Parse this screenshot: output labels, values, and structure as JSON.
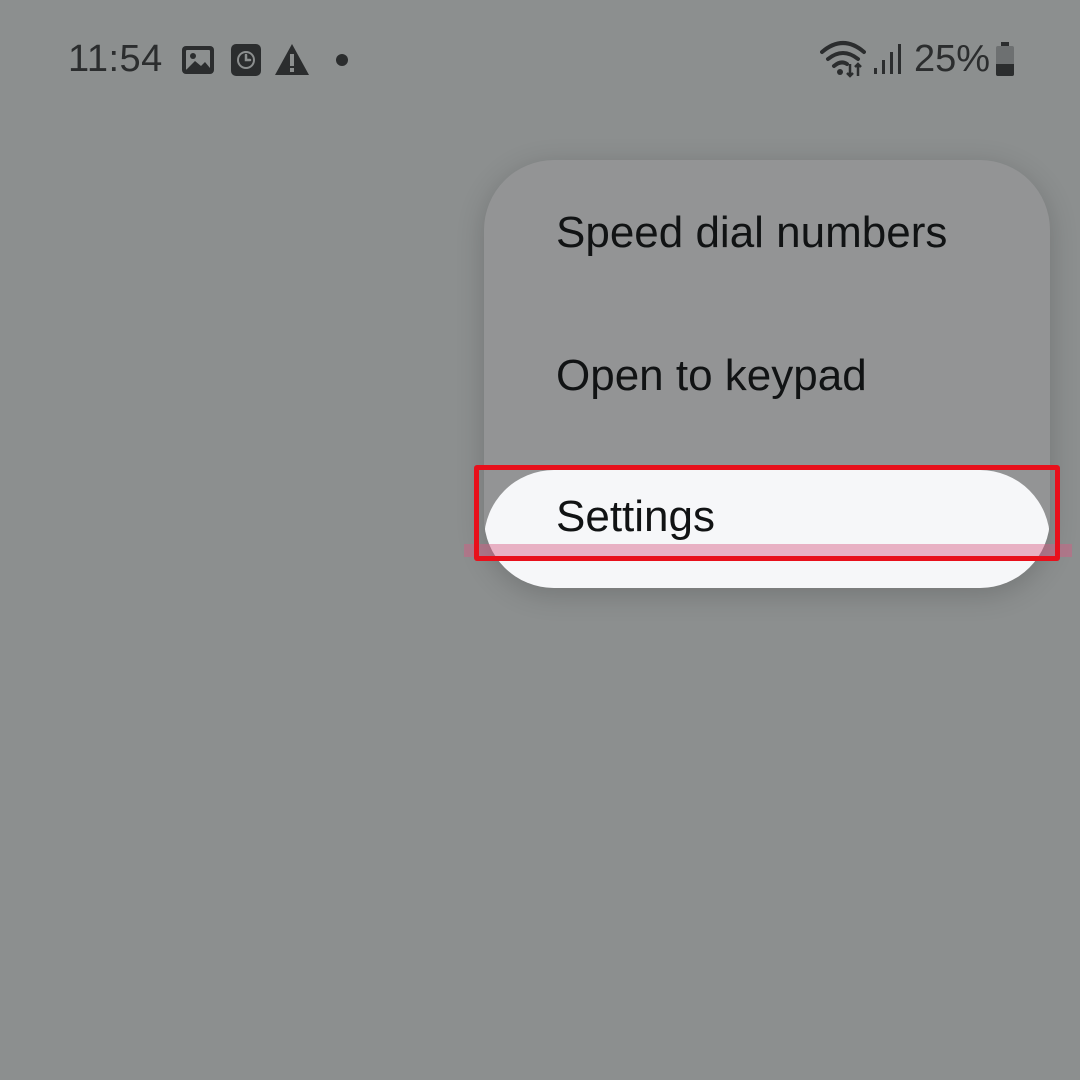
{
  "status_bar": {
    "time": "11:54",
    "notification_icons": [
      "image-icon",
      "clock-icon",
      "warning-icon",
      "dot-icon"
    ],
    "wifi_icon": "wifi-icon",
    "signal_icon": "signal-icon",
    "battery_percent": "25%",
    "battery_icon": "battery-icon"
  },
  "menu": {
    "items": [
      {
        "label": "Speed dial numbers"
      },
      {
        "label": "Open to keypad"
      },
      {
        "label": "Settings"
      }
    ]
  },
  "colors": {
    "background": "#8c8f8f",
    "menu_background": "#939495",
    "highlight_item": "#f6f7f9",
    "annotation": "#e8101b",
    "text": "#111314"
  }
}
